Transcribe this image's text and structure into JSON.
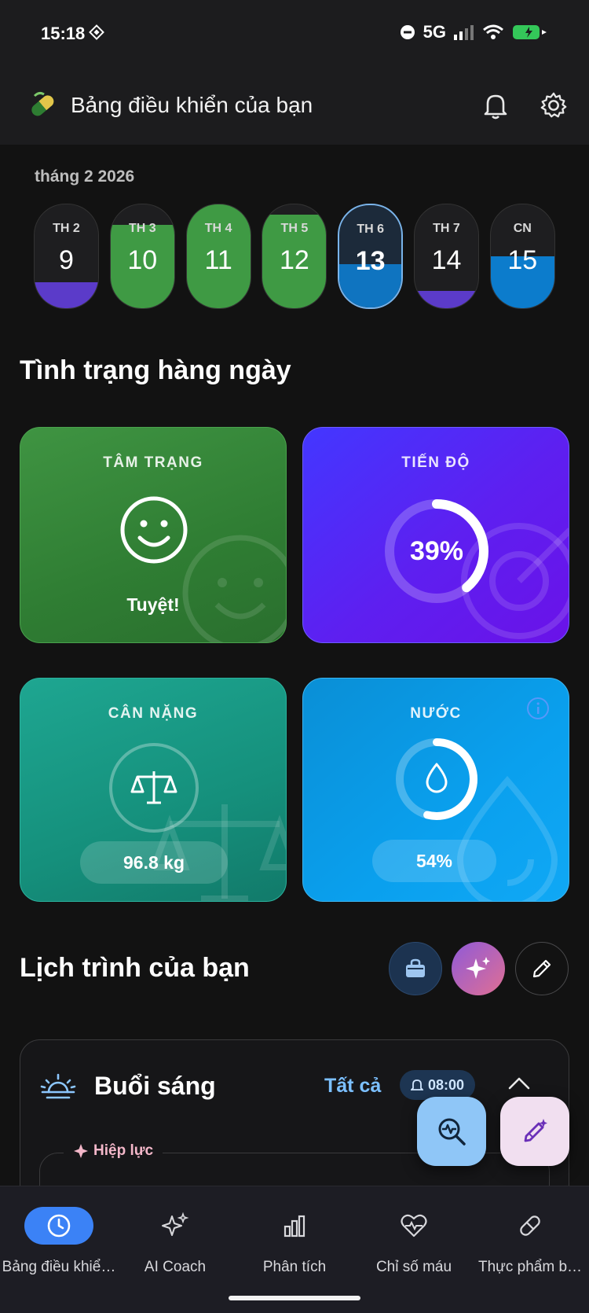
{
  "status_bar": {
    "time": "15:18",
    "network": "5G"
  },
  "header": {
    "title": "Bảng điều khiển của bạn"
  },
  "calendar": {
    "month": "tháng 2 2026",
    "days": [
      {
        "label": "TH 2",
        "num": "9",
        "fill": 0.25,
        "color": "#5b3bc9"
      },
      {
        "label": "TH 3",
        "num": "10",
        "fill": 0.8,
        "color": "#3f9a44"
      },
      {
        "label": "TH 4",
        "num": "11",
        "fill": 1.0,
        "color": "#3f9a44"
      },
      {
        "label": "TH 5",
        "num": "12",
        "fill": 0.9,
        "color": "#3f9a44"
      },
      {
        "label": "TH 6",
        "num": "13",
        "fill": 0.42,
        "color": "#0f74c0"
      },
      {
        "label": "TH 7",
        "num": "14",
        "fill": 0.17,
        "color": "#5b3bc9"
      },
      {
        "label": "CN",
        "num": "15",
        "fill": 0.5,
        "color": "#0c7ccc"
      }
    ],
    "selected_index": 4
  },
  "daily": {
    "heading": "Tình trạng hàng ngày",
    "mood": {
      "title": "TÂM TRẠNG",
      "value": "Tuyệt!"
    },
    "progress": {
      "title": "TIẾN ĐỘ",
      "value": "39%",
      "percent": 39
    },
    "weight": {
      "title": "CÂN NẶNG",
      "value": "96.8 kg"
    },
    "water": {
      "title": "NƯỚC",
      "value": "54%",
      "percent": 54
    }
  },
  "schedule": {
    "heading": "Lịch trình của bạn",
    "morning": {
      "name": "Buổi sáng",
      "all_label": "Tất cả",
      "alarm": "08:00"
    },
    "synergy_label": "Hiệp lực"
  },
  "nav": {
    "items": [
      {
        "label": "Bảng điều khiể…",
        "icon": "clock-icon",
        "active": true
      },
      {
        "label": "AI Coach",
        "icon": "sparkles-icon",
        "active": false
      },
      {
        "label": "Phân tích",
        "icon": "bar-chart-icon",
        "active": false
      },
      {
        "label": "Chỉ số máu",
        "icon": "heart-pulse-icon",
        "active": false
      },
      {
        "label": "Thực phẩm b…",
        "icon": "pill-icon",
        "active": false
      }
    ]
  },
  "colors": {
    "accent": "#3b82f6",
    "mood": "#3f9442",
    "progress": "#5e1ff0",
    "weight": "#15907c",
    "water": "#0aa0ee"
  }
}
